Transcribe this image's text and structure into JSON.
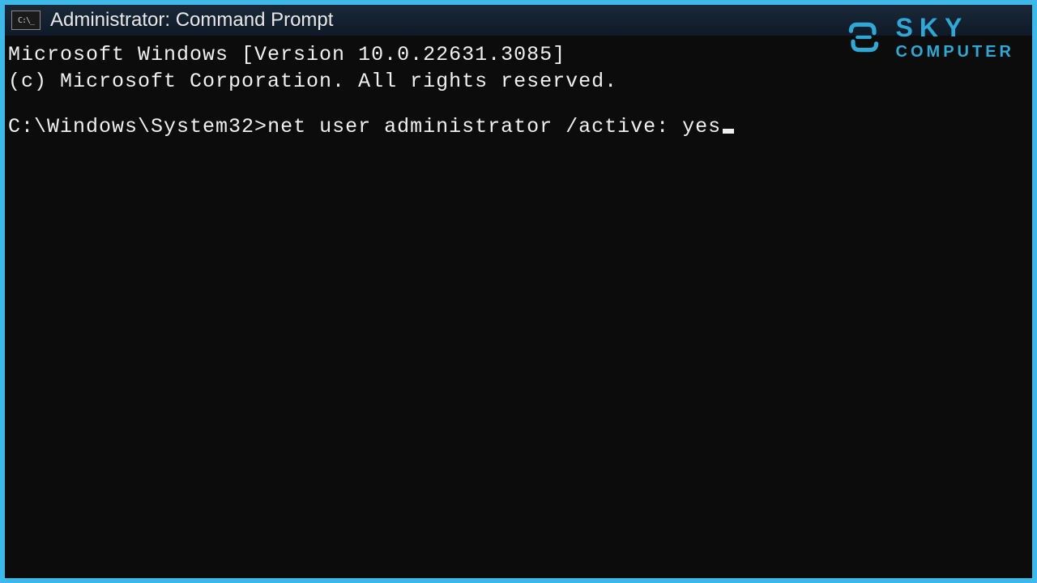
{
  "titlebar": {
    "icon_text": "C:\\_",
    "title": "Administrator: Command Prompt"
  },
  "terminal": {
    "banner_line1": "Microsoft Windows [Version 10.0.22631.3085]",
    "banner_line2": "(c) Microsoft Corporation. All rights reserved.",
    "prompt": "C:\\Windows\\System32>",
    "command": "net user administrator /active: yes"
  },
  "watermark": {
    "line1": "SKY",
    "line2": "COMPUTER",
    "color": "#2fa8d6"
  }
}
